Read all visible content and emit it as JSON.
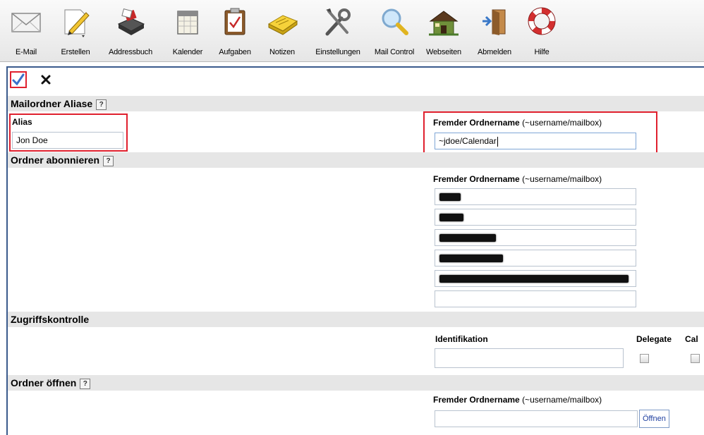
{
  "toolbar": {
    "items": [
      {
        "label": "E-Mail",
        "icon": "envelope-icon"
      },
      {
        "label": "Erstellen",
        "icon": "compose-pencil-icon"
      },
      {
        "label": "Addressbuch",
        "icon": "addressbook-icon"
      },
      {
        "label": "Kalender",
        "icon": "calendar-icon"
      },
      {
        "label": "Aufgaben",
        "icon": "tasks-clipboard-icon"
      },
      {
        "label": "Notizen",
        "icon": "notes-icon"
      },
      {
        "label": "Einstellungen",
        "icon": "tools-icon"
      },
      {
        "label": "Mail Control",
        "icon": "magnifier-icon"
      },
      {
        "label": "Webseiten",
        "icon": "house-icon"
      },
      {
        "label": "Abmelden",
        "icon": "logout-door-icon"
      },
      {
        "label": "Hilfe",
        "icon": "lifebuoy-icon"
      }
    ]
  },
  "actions": {
    "save_glyph": "✓",
    "cancel_glyph": "✕"
  },
  "help_glyph": "?",
  "aliases": {
    "title": "Mailordner Aliase",
    "alias_label": "Alias",
    "alias_value": "Jon Doe",
    "foreign_label": "Fremder Ordnername",
    "foreign_hint": "(~username/mailbox)",
    "foreign_value": "~jdoe/Calendar"
  },
  "subscribe": {
    "title": "Ordner abonnieren",
    "foreign_label": "Fremder Ordnername",
    "foreign_hint": "(~username/mailbox)",
    "rows": [
      "",
      "",
      "",
      "",
      "",
      ""
    ]
  },
  "access": {
    "title": "Zugriffskontrolle",
    "identification_label": "Identifikation",
    "identification_value": "",
    "delegate_label": "Delegate",
    "cal_label": "Cal",
    "delegate_checked": false,
    "cal_checked": false
  },
  "open_folder": {
    "title": "Ordner öffnen",
    "foreign_label": "Fremder Ordnername",
    "foreign_hint": "(~username/mailbox)",
    "value": "",
    "button_label": "Öffnen"
  },
  "colors": {
    "highlight_border": "#e0202e",
    "section_bg": "#e6e6e6",
    "panel_border": "#3a5a8c",
    "save_check": "#3b6fc9"
  }
}
